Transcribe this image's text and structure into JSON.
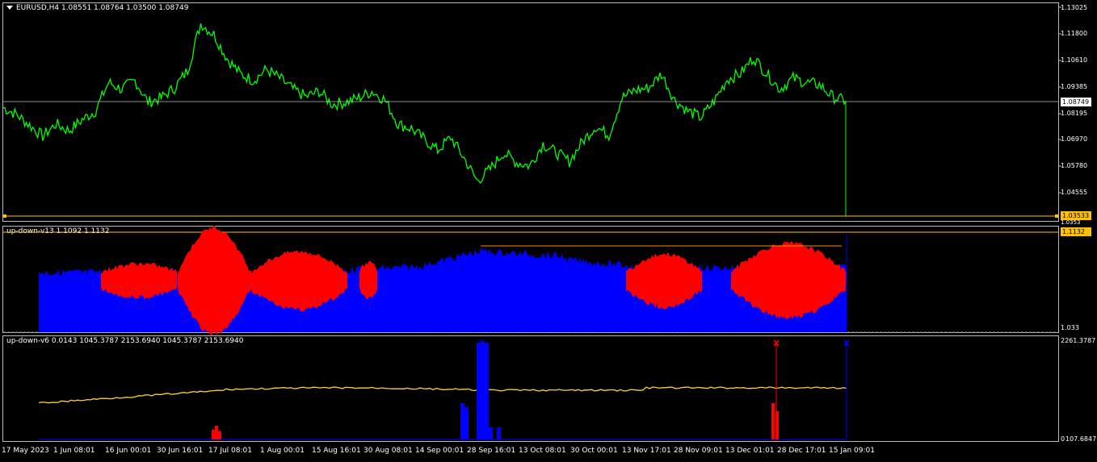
{
  "main_chart": {
    "title": "EURUSD,H4  1.08551 1.08764 1.03500 1.08749",
    "y_labels": [
      "1.13025",
      "1.11800",
      "1.10610",
      "1.09385",
      "1.08195",
      "1.06970",
      "1.05780",
      "1.04555"
    ],
    "current_price": "1.08749",
    "low_marker": "1.03533",
    "line_color": "#00ff00"
  },
  "indicator1": {
    "title": "up-down-v13 1.1092 1.1132",
    "top_value": "1.1132",
    "secondary_value": "1.0353",
    "bottom_value": "1.033",
    "colors": {
      "up": "#0000ff",
      "down": "#ff0000"
    }
  },
  "indicator2": {
    "title": "up-down-v6 0.0143 1045.3787 2153.6940 1045.3787 2153.6940",
    "top_value": "2261.3787",
    "bottom_value": "107.6847",
    "bottom_overlap": "0",
    "marker_symbol": "x",
    "colors": {
      "line": "#ffd040",
      "blue": "#0000ff",
      "red": "#ff0000"
    }
  },
  "x_axis": {
    "labels": [
      "17 May 2023",
      "1 Jun 08:01",
      "16 Jun 00:01",
      "30 Jun 16:01",
      "17 Jul 08:01",
      "1 Aug 00:01",
      "15 Aug 16:01",
      "30 Aug 08:01",
      "14 Sep 00:01",
      "28 Sep 16:01",
      "13 Oct 08:01",
      "30 Oct 00:01",
      "13 Nov 17:01",
      "28 Nov 09:01",
      "13 Dec 01:01",
      "28 Dec 17:01",
      "15 Jan 09:01"
    ]
  },
  "chart_data": {
    "type": "line",
    "title": "EURUSD,H4  1.08551 1.08764 1.03500 1.08749",
    "xlabel": "",
    "ylabel": "",
    "ylim": [
      1.035,
      1.1315
    ],
    "series": [
      {
        "values": [
          1.0845,
          1.0815,
          1.0765,
          1.0715,
          1.077,
          1.074,
          1.079,
          1.083,
          1.096,
          1.093,
          1.097,
          1.087,
          1.089,
          1.0935,
          1.1015,
          1.123,
          1.118,
          1.107,
          1.1,
          1.097,
          1.102,
          1.098,
          1.093,
          1.0895,
          1.092,
          1.086,
          1.087,
          1.089,
          1.092,
          1.088,
          1.077,
          1.075,
          1.07,
          1.065,
          1.071,
          1.0615,
          1.051,
          1.0565,
          1.064,
          1.0595,
          1.058,
          1.068,
          1.064,
          1.06,
          1.069,
          1.076,
          1.072,
          1.089,
          1.0925,
          1.0935,
          1.1,
          1.088,
          1.083,
          1.08,
          1.0875,
          1.0975,
          1.1,
          1.1075,
          1.1,
          1.093,
          1.098,
          1.096,
          1.095,
          1.0895,
          1.0875
        ]
      }
    ]
  }
}
